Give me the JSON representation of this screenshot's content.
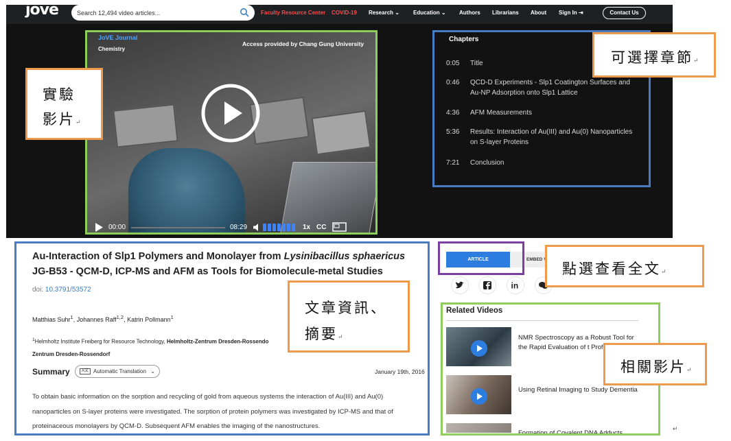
{
  "header": {
    "logo": "jove",
    "search_placeholder": "Search 12,494 video articles...",
    "nav": {
      "faculty": "Faculty Resource Center",
      "covid": "COVID-19",
      "research": "Research",
      "education": "Education",
      "authors": "Authors",
      "librarians": "Librarians",
      "about": "About",
      "signin": "Sign In",
      "contact": "Contact Us"
    }
  },
  "video": {
    "journal": "JoVE Journal",
    "section": "Chemistry",
    "access": "Access provided by Chang Gung University",
    "current_time": "00:00",
    "duration": "08:29",
    "speed": "1x",
    "cc": "CC",
    "volume_level": 1.0
  },
  "chapters": {
    "title": "Chapters",
    "items": [
      {
        "time": "0:05",
        "label": "Title"
      },
      {
        "time": "0:46",
        "label": "QCD-D Experiments - Slp1 Coatington Surfaces and Au-NP Adsorption onto Slp1 Lattice"
      },
      {
        "time": "4:36",
        "label": "AFM Measurements"
      },
      {
        "time": "5:36",
        "label": "Results: Interaction of Au(III) and Au(0) Nanoparticles on S-layer Proteins"
      },
      {
        "time": "7:21",
        "label": "Conclusion"
      }
    ]
  },
  "article": {
    "title_a": "Au-Interaction of Slp1 Polymers and Monolayer from ",
    "title_italic": "Lysinibacillus sphaericus",
    "title_b": " JG-B53 - QCM-D, ICP-MS and AFM as Tools for Biomolecule-metal Studies",
    "doi_label": "doi:",
    "doi": "10.3791/53572",
    "authors": [
      {
        "name": "Matthias Suhr",
        "sup": "1"
      },
      {
        "name": "Johannes Raff",
        "sup": "1,2"
      },
      {
        "name": "Katrin Pollmann",
        "sup": "1"
      }
    ],
    "affil_sup": "1",
    "affil_a": "Helmholtz Institute Freiberg for Resource Technology, ",
    "affil_b": "Helmholtz-Zentrum Dresden-Rossendo",
    "affil_c": "Zentrum Dresden-Rossendorf",
    "summary_heading": "Summary",
    "translate_badge": "A文",
    "translate_label": "Automatic Translation",
    "date": "January 19th, 2016",
    "summary_text": "To obtain basic information on the sorption and recycling of gold from aqueous systems the interaction of Au(III) and Au(0) nanoparticles on S-layer proteins were investigated. The sorption of protein polymers was investigated by ICP-MS and that of proteinaceous monolayers by QCM-D. Subsequent AFM enables the imaging of the nanostructures."
  },
  "side": {
    "tab_article": "ARTICLE",
    "tab_embed": "EMBED V",
    "related_title": "Related Videos",
    "related": [
      {
        "title": "NMR Spectroscopy as a Robust Tool for the Rapid Evaluation of t Profile ..."
      },
      {
        "title": "Using Retinal Imaging to Study Dementia"
      },
      {
        "title": "Formation of Covalent DNA Adducts"
      }
    ]
  },
  "annotations": {
    "video": "實驗影片",
    "video_l1": "實驗",
    "video_l2": "影片",
    "chapters": "可選擇章節",
    "fulltext": "點選查看全文",
    "info_l1": "文章資訊、",
    "info_l2": "摘要",
    "related": "相關影片",
    "mark": "↵"
  },
  "colors": {
    "accent": "#2d7de0",
    "frame_green": "#8ecf5c",
    "frame_blue": "#4a7cc4",
    "frame_orange": "#ef9a4b",
    "frame_purple": "#7a3fa0",
    "nav_red": "#ff4a4a"
  }
}
